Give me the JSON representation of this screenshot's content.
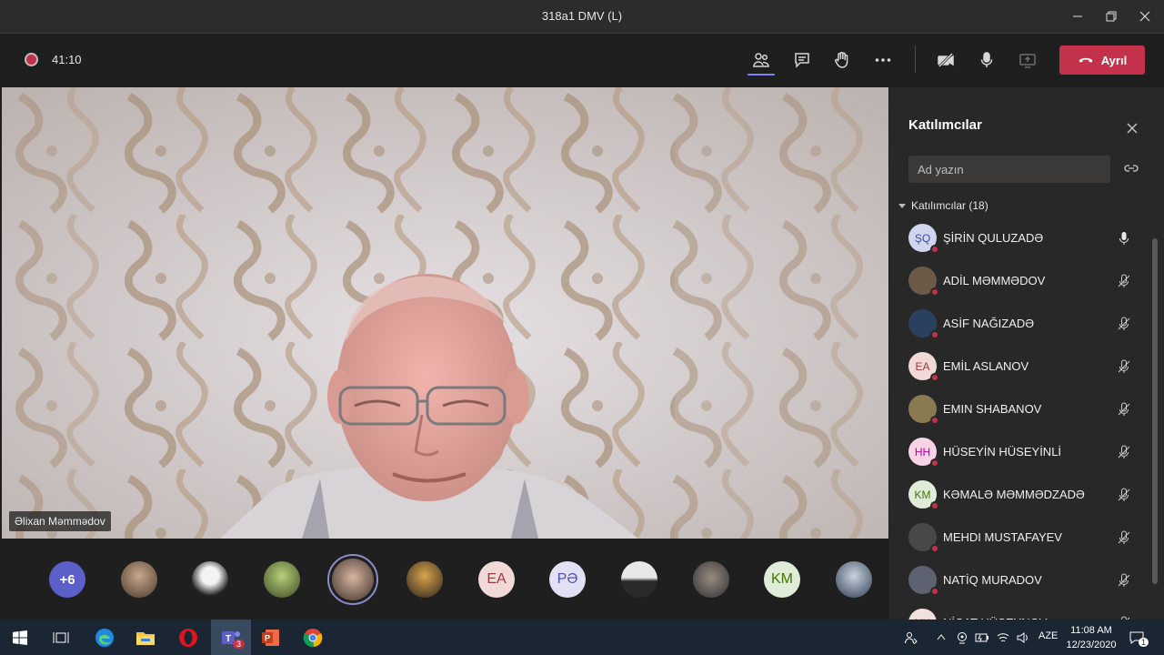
{
  "window": {
    "title": "318a1 DMV (L)"
  },
  "toolbar": {
    "timer": "41:10",
    "leave_label": "Ayrıl"
  },
  "stage": {
    "speaker_name": "Əlixan Məmmədov"
  },
  "strip": {
    "more_count": "+6",
    "avatars": [
      "photo",
      "photo",
      "photo",
      "photo-active",
      "photo",
      "EA",
      "PƏ",
      "photo",
      "photo",
      "KM",
      "photo"
    ]
  },
  "panel": {
    "title": "Katılımcılar",
    "search_placeholder": "Ad yazın",
    "section_label": "Katılımcılar (18)",
    "participants": [
      {
        "initials": "ŞQ",
        "name": "ŞİRİN QULUZADƏ",
        "mic": "on",
        "color": "#d0d6ef",
        "text": "#3b4aa0"
      },
      {
        "initials": "",
        "name": "ADİL MƏMMƏDOV",
        "mic": "off",
        "color": "#6b5a48",
        "text": "#fff"
      },
      {
        "initials": "",
        "name": "ASİF NAĞIZADƏ",
        "mic": "off",
        "color": "#2b3f5e",
        "text": "#fff"
      },
      {
        "initials": "EA",
        "name": "EMİL ASLANOV",
        "mic": "off",
        "color": "#f1d9d7",
        "text": "#a4373a"
      },
      {
        "initials": "",
        "name": "EMIN SHABANOV",
        "mic": "off",
        "color": "#8a7a52",
        "text": "#fff"
      },
      {
        "initials": "HH",
        "name": "HÜSEYİN HÜSEYİNLİ",
        "mic": "off",
        "color": "#f6d4e6",
        "text": "#b4009e"
      },
      {
        "initials": "KM",
        "name": "KƏMALƏ MƏMMƏDZADƏ",
        "mic": "off",
        "color": "#e0ecd8",
        "text": "#437406"
      },
      {
        "initials": "",
        "name": "MEHDI MUSTAFAYEV",
        "mic": "off",
        "color": "#4a4846",
        "text": "#fff"
      },
      {
        "initials": "",
        "name": "NATİQ MURADOV",
        "mic": "off",
        "color": "#5c6270",
        "text": "#fff"
      },
      {
        "initials": "NH",
        "name": "NİCAT HÜSEYNOV",
        "mic": "off",
        "color": "#f1e0dc",
        "text": "#8a3c2a"
      }
    ]
  },
  "taskbar": {
    "teams_badge": "3",
    "lang": "AZE",
    "time": "11:08 AM",
    "date": "12/23/2020",
    "notify_count": "1"
  },
  "colors": {
    "accent": "#7f85f5",
    "leave": "#c4314b",
    "presence_busy": "#c4314b"
  }
}
